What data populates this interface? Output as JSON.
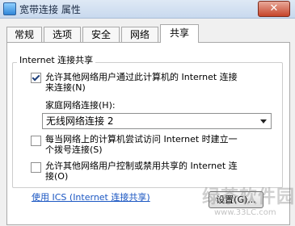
{
  "window": {
    "title": "宽带连接 属性",
    "close_label": "✕"
  },
  "tabs": [
    {
      "label": "常规"
    },
    {
      "label": "选项"
    },
    {
      "label": "安全"
    },
    {
      "label": "网络"
    },
    {
      "label": "共享"
    }
  ],
  "group": {
    "title": "Internet 连接共享"
  },
  "option1": {
    "checked": true,
    "line1": "允许其他网络用户通过此计算机的 Internet 连接",
    "line2": "来连接(N)"
  },
  "home_network": {
    "label": "家庭网络连接(H):",
    "value": "无线网络连接 2"
  },
  "option2": {
    "checked": false,
    "line1": "每当网络上的计算机尝试访问 Internet 时建立一",
    "line2": "个拨号连接(S)"
  },
  "option3": {
    "checked": false,
    "line1": "允许其他网络用户控制或禁用共享的 Internet 连",
    "line2": "接(O)"
  },
  "ics_link": "使用 ICS (Internet 连接共享)",
  "settings_button": "设置(G)...",
  "watermark": {
    "main": "绿茶软件园",
    "url": "www.33LC.com"
  }
}
